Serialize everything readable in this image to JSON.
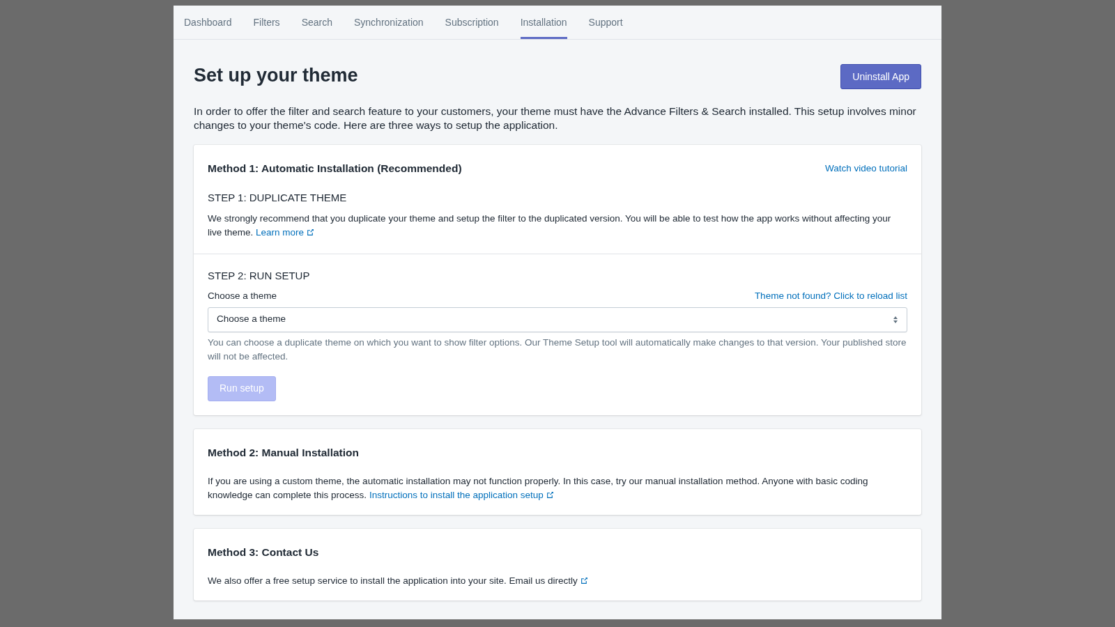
{
  "tabs": [
    {
      "label": "Dashboard",
      "selected": false
    },
    {
      "label": "Filters",
      "selected": false
    },
    {
      "label": "Search",
      "selected": false
    },
    {
      "label": "Synchronization",
      "selected": false
    },
    {
      "label": "Subscription",
      "selected": false
    },
    {
      "label": "Installation",
      "selected": true
    },
    {
      "label": "Support",
      "selected": false
    }
  ],
  "header": {
    "title": "Set up your theme",
    "button": "Uninstall App"
  },
  "intro": "In order to offer the filter and search feature to your customers, your theme must have the Advance Filters & Search installed. This setup involves minor changes to your theme's code. Here are three ways to setup the application.",
  "method_1": {
    "title": "Method 1: Automatic Installation (Recommended)",
    "link": "Watch video tutorial",
    "step_1": {
      "heading": "STEP 1: DUPLICATE THEME",
      "text": "We strongly recommend that you duplicate your theme and setup the filter to the duplicated version. You will be able to test how the app works without affecting your live theme.",
      "link": "Learn more"
    },
    "step_2": {
      "heading": "STEP 2: RUN SETUP",
      "label": "Choose a theme",
      "reload_link": "Theme not found? Click to reload list",
      "select": {
        "value": "Choose a theme"
      },
      "help": "You can choose a duplicate theme on which you want to show filter options. Our Theme Setup tool will automatically make changes to that version. Your published store will not be affected.",
      "button": {
        "label": "Run setup",
        "disabled": true
      }
    }
  },
  "method_2": {
    "title": "Method 2: Manual Installation",
    "text": "If you are using a custom theme, the automatic installation may not function properly. In this case, try our manual installation method. Anyone with basic coding knowledge can complete this process.",
    "link": "Instructions to install the application setup"
  },
  "method_3": {
    "title": "Method 3: Contact Us",
    "text": "We also offer a free setup service to install the application into your site.",
    "link": "Email us directly"
  }
}
